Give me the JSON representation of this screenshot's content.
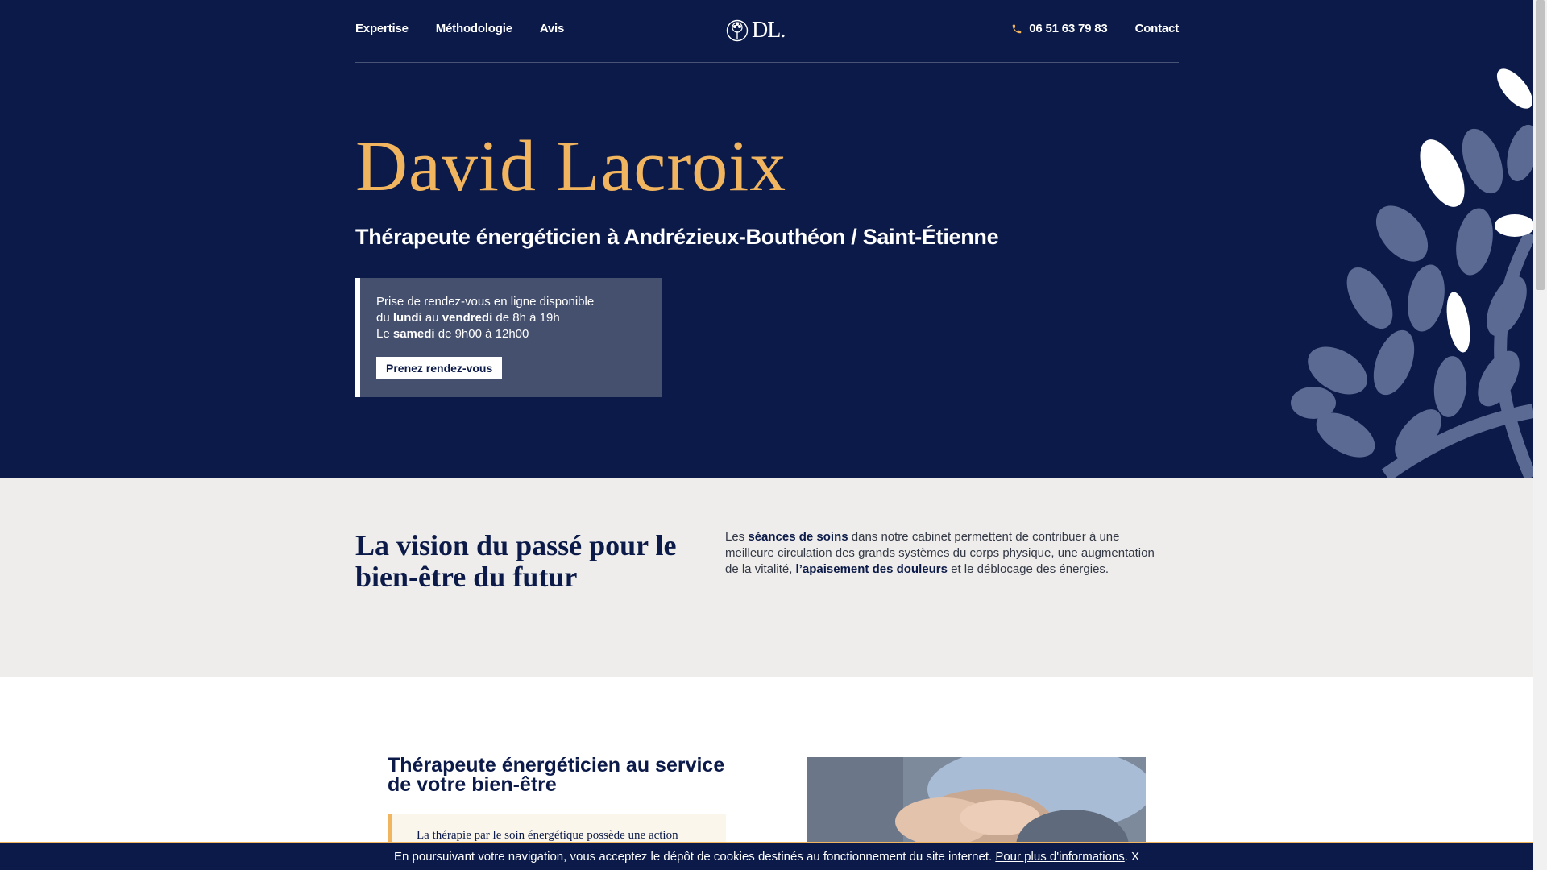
{
  "nav": {
    "links": [
      "Expertise",
      "Méthodologie",
      "Avis"
    ],
    "logo_text": "DL.",
    "phone": "06 51 63 79 83",
    "contact": "Contact"
  },
  "hero": {
    "title": "David Lacroix",
    "subtitle": "Thérapeute énergéticien à Andrézieux-Bouthéon / Saint-Étienne",
    "booking": {
      "line1": "Prise de rendez-vous en ligne disponible",
      "line2_a": "du ",
      "line2_b": "lundi",
      "line2_c": " au ",
      "line2_d": "vendredi",
      "line2_e": " de 8h à 19h",
      "line3_a": "Le ",
      "line3_b": "samedi",
      "line3_c": " de 9h00 à 12h00",
      "button": "Prenez rendez-vous"
    }
  },
  "vision": {
    "title": "La vision du passé pour le bien-être du futur",
    "text_a": "Les ",
    "text_b": "séances de soins",
    "text_c": " dans notre cabinet permettent de contribuer à une meilleure circulation des grands systèmes du corps physique, une augmentation de la vitalité, ",
    "text_d": "l’apaisement des douleurs",
    "text_e": " et le déblocage des énergies."
  },
  "service": {
    "title": "Thérapeute énergéticien au service de votre bien-être",
    "quote": "La thérapie par le soin énergétique possède une action"
  },
  "cookie": {
    "text": "En poursuivant votre navigation, vous acceptez le dépôt de cookies destinés au fonctionnement du site internet. ",
    "link": "Pour plus d'informations",
    "period": ".",
    "close": "X"
  },
  "colors": {
    "navy": "#0b1a48",
    "gold": "#f1b45f",
    "booking_bg": "#45506f",
    "leaf": "#5a6a93"
  },
  "icons": [
    "tree-logo-icon",
    "phone-icon"
  ]
}
